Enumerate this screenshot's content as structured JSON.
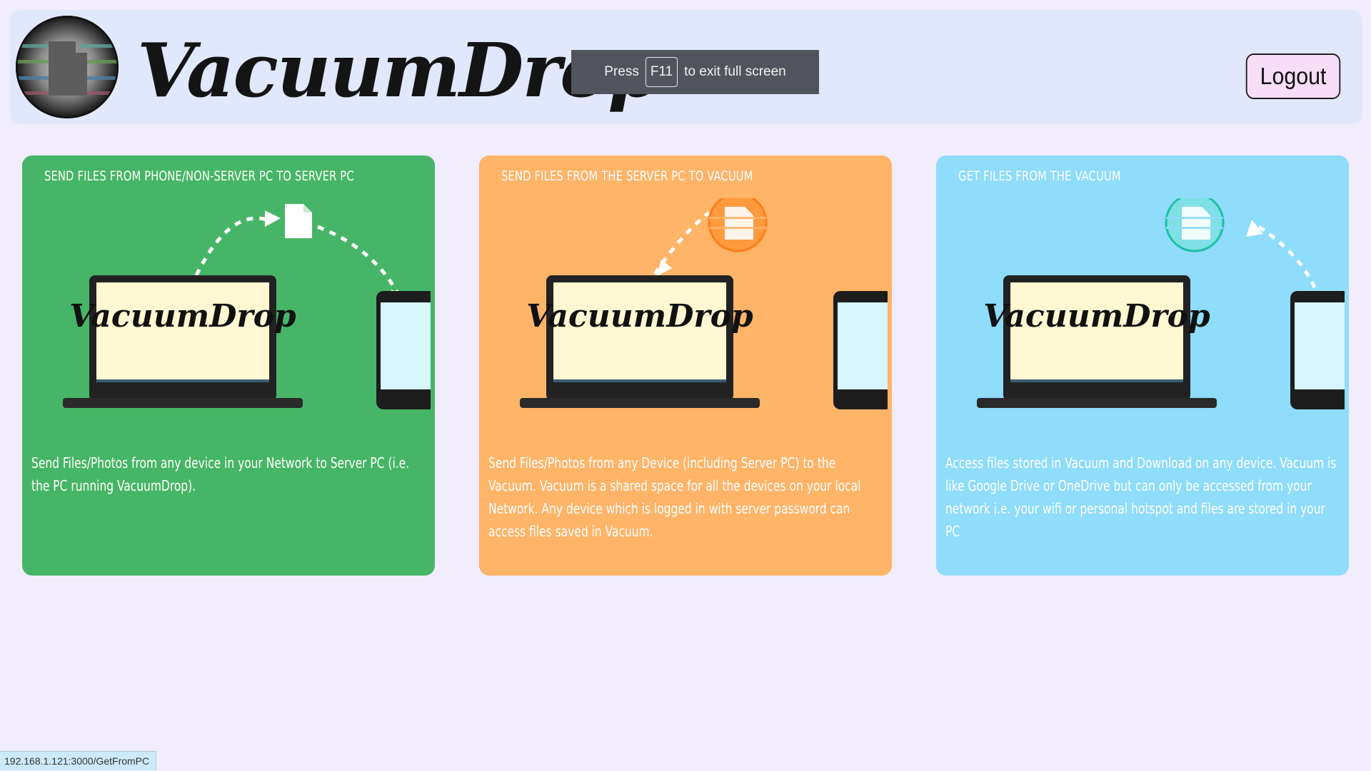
{
  "header": {
    "app_name": "VacuumDrop",
    "logout_label": "Logout"
  },
  "fullscreen_banner": {
    "press": "Press",
    "key": "F11",
    "suffix": "to exit full screen"
  },
  "cards": [
    {
      "title": "SEND FILES FROM PHONE/NON-SERVER PC TO SERVER PC",
      "laptop_text": "VacuumDrop",
      "description": "Send Files/Photos from any device in your Network to Server PC (i.e. the PC running VacuumDrop).",
      "color": "#47b567"
    },
    {
      "title": "SEND FILES FROM THE SERVER PC TO VACUUM",
      "laptop_text": "VacuumDrop",
      "description": "Send Files/Photos from any Device (including Server PC) to the Vacuum. Vacuum is a shared space for all the devices on your local Network. Any device which is logged in with server password can access files saved in Vacuum.",
      "color": "#ffb468"
    },
    {
      "title": "GET FILES FROM THE VACUUM",
      "laptop_text": "VacuumDrop",
      "description": "Access files stored in Vacuum and Download on any device. Vacuum is like Google Drive or OneDrive but can only be accessed from your network i.e. your wifi or personal hotspot and files are stored in your PC",
      "color": "#8fdcfb"
    }
  ],
  "status_bar": {
    "url": "192.168.1.121:3000/GetFromPC"
  },
  "icons": {
    "logo": "vacuum-file-logo-icon",
    "file": "file-icon",
    "laptop": "laptop-icon",
    "phone": "phone-icon"
  }
}
